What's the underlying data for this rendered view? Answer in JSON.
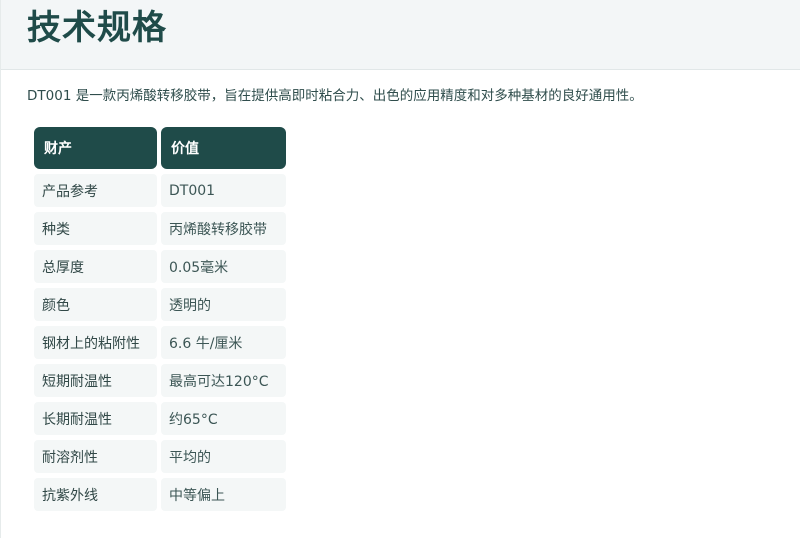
{
  "page": {
    "title": "技术规格",
    "intro": "DT001 是一款丙烯酸转移胶带，旨在提供高即时粘合力、出色的应用精度和对多种基材的良好通用性。"
  },
  "table": {
    "headers": {
      "property": "财产",
      "value": "价值"
    },
    "rows": [
      {
        "property": "产品参考",
        "value": "DT001"
      },
      {
        "property": "种类",
        "value": "丙烯酸转移胶带"
      },
      {
        "property": "总厚度",
        "value": "0.05毫米"
      },
      {
        "property": "颜色",
        "value": "透明的"
      },
      {
        "property": "钢材上的粘附性",
        "value": "6.6 牛/厘米"
      },
      {
        "property": "短期耐温性",
        "value": "最高可达120°C"
      },
      {
        "property": "长期耐温性",
        "value": "约65°C"
      },
      {
        "property": "耐溶剂性",
        "value": "平均的"
      },
      {
        "property": "抗紫外线",
        "value": "中等偏上"
      }
    ]
  },
  "colors": {
    "accent": "#1f4b49",
    "header_bg": "#f3f6f7",
    "cell_bg": "#f4f7f7"
  }
}
